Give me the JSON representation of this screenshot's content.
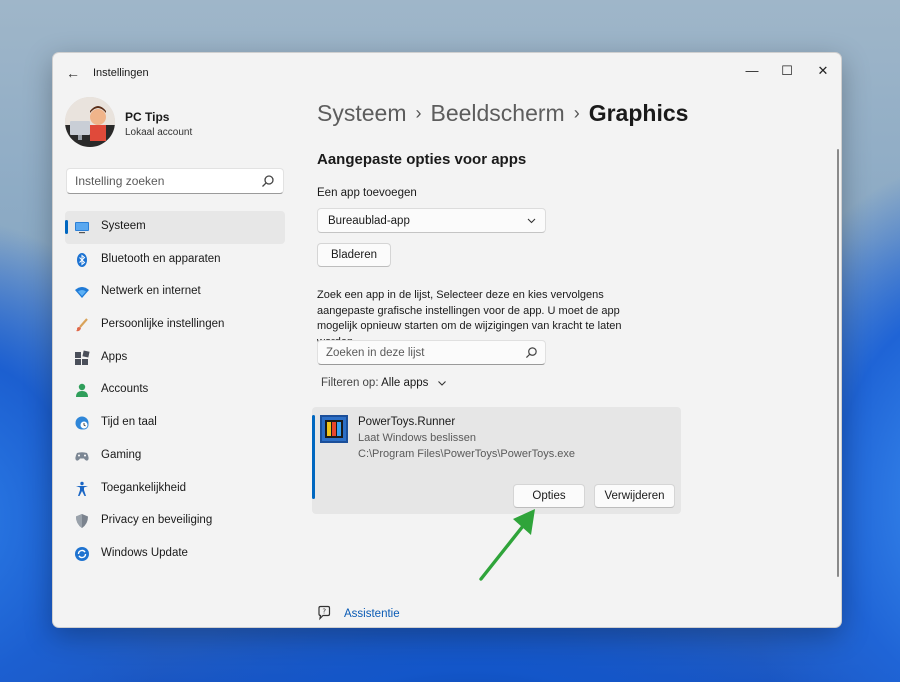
{
  "window": {
    "title": "Instellingen",
    "controls": {
      "minimize": "—",
      "maximize": "☐",
      "close": "✕"
    }
  },
  "profile": {
    "name": "PC Tips",
    "account_type": "Lokaal account"
  },
  "search": {
    "placeholder": "Instelling zoeken"
  },
  "sidebar": {
    "items": [
      {
        "label": "Systeem",
        "icon": "monitor-icon",
        "active": true
      },
      {
        "label": "Bluetooth en apparaten",
        "icon": "bluetooth-icon"
      },
      {
        "label": "Netwerk en internet",
        "icon": "wifi-icon"
      },
      {
        "label": "Persoonlijke instellingen",
        "icon": "brush-icon"
      },
      {
        "label": "Apps",
        "icon": "apps-icon"
      },
      {
        "label": "Accounts",
        "icon": "person-icon"
      },
      {
        "label": "Tijd en taal",
        "icon": "globe-clock-icon"
      },
      {
        "label": "Gaming",
        "icon": "gamepad-icon"
      },
      {
        "label": "Toegankelijkheid",
        "icon": "accessibility-icon"
      },
      {
        "label": "Privacy en beveiliging",
        "icon": "shield-icon"
      },
      {
        "label": "Windows Update",
        "icon": "update-icon"
      }
    ]
  },
  "breadcrumb": {
    "items": [
      "Systeem",
      "Beeldscherm",
      "Graphics"
    ],
    "separator": "›"
  },
  "main": {
    "section_title": "Aangepaste opties voor apps",
    "add_app_label": "Een app toevoegen",
    "app_type_dropdown": {
      "selected": "Bureaublad-app"
    },
    "browse_button": "Bladeren",
    "description": "Zoek een app in de lijst, Selecteer deze en kies vervolgens aangepaste grafische instellingen voor de app. U moet de app mogelijk opnieuw starten om de wijzigingen van kracht te laten worden.",
    "list_search": {
      "placeholder": "Zoeken in deze lijst"
    },
    "filter": {
      "label": "Filteren op:",
      "value": "Alle apps"
    },
    "apps": [
      {
        "name": "PowerToys.Runner",
        "preference": "Laat Windows beslissen",
        "path": "C:\\Program Files\\PowerToys\\PowerToys.exe",
        "options_button": "Opties",
        "remove_button": "Verwijderen"
      }
    ]
  },
  "help": {
    "label": "Assistentie"
  },
  "colors": {
    "accent": "#0067c0",
    "link": "#0a5bb5",
    "annotation_arrow": "#2fa43a"
  }
}
